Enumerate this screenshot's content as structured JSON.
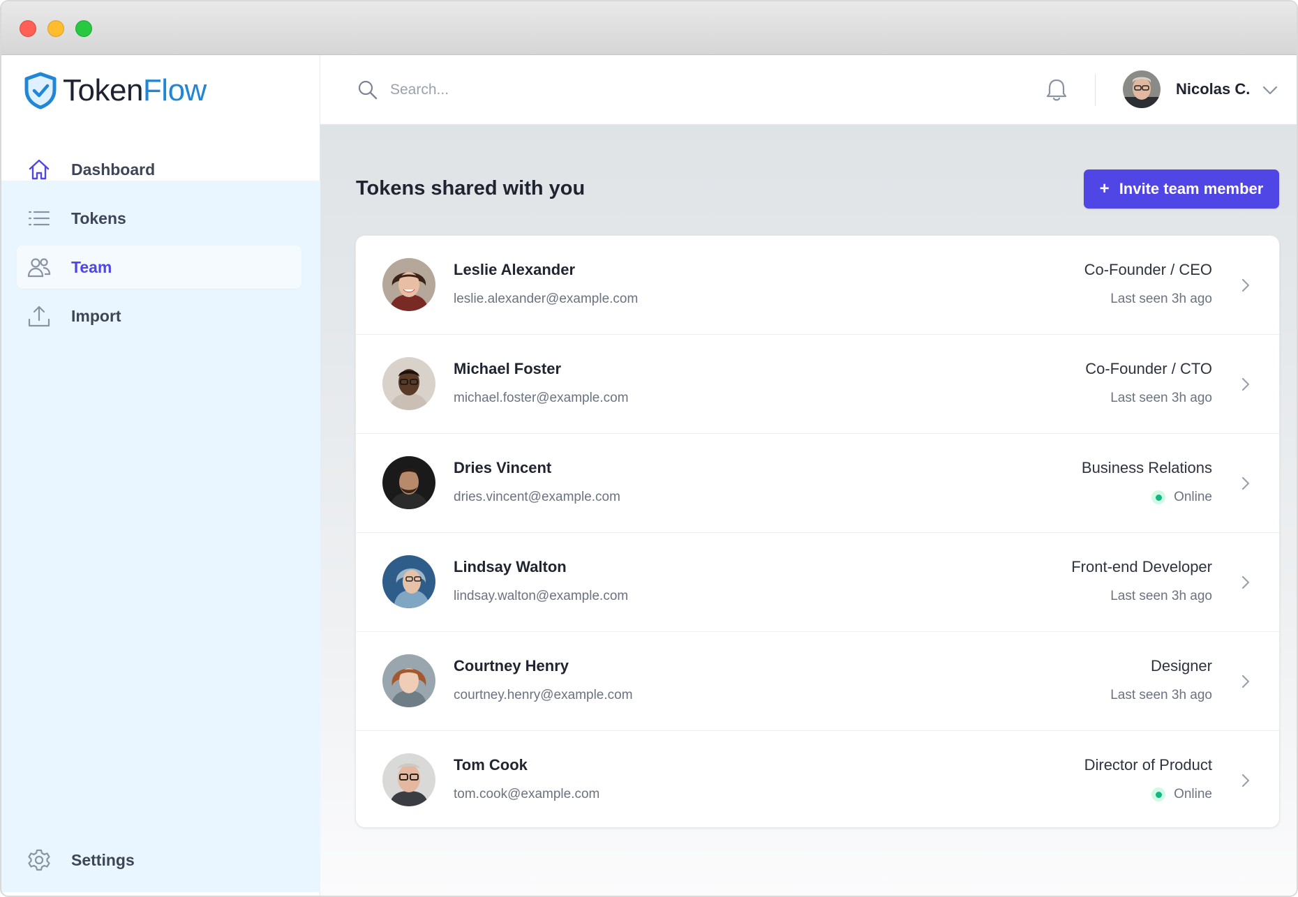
{
  "app": {
    "logo_part1": "Token",
    "logo_part2": "Flow"
  },
  "sidebar": {
    "items": [
      {
        "label": "Dashboard",
        "icon": "home-icon"
      },
      {
        "label": "Tokens",
        "icon": "list-icon"
      },
      {
        "label": "Team",
        "icon": "users-icon",
        "active": true
      },
      {
        "label": "Import",
        "icon": "upload-icon"
      }
    ],
    "settings_label": "Settings"
  },
  "topbar": {
    "search_placeholder": "Search...",
    "user_name": "Nicolas C."
  },
  "page": {
    "title": "Tokens shared with you",
    "invite_plus": "+",
    "invite_label": "Invite team member"
  },
  "members": [
    {
      "name": "Leslie Alexander",
      "email": "leslie.alexander@example.com",
      "role": "Co-Founder / CEO",
      "status": "Last seen 3h ago",
      "online": false
    },
    {
      "name": "Michael Foster",
      "email": "michael.foster@example.com",
      "role": "Co-Founder / CTO",
      "status": "Last seen 3h ago",
      "online": false
    },
    {
      "name": "Dries Vincent",
      "email": "dries.vincent@example.com",
      "role": "Business Relations",
      "status": "Online",
      "online": true
    },
    {
      "name": "Lindsay Walton",
      "email": "lindsay.walton@example.com",
      "role": "Front-end Developer",
      "status": "Last seen 3h ago",
      "online": false
    },
    {
      "name": "Courtney Henry",
      "email": "courtney.henry@example.com",
      "role": "Designer",
      "status": "Last seen 3h ago",
      "online": false
    },
    {
      "name": "Tom Cook",
      "email": "tom.cook@example.com",
      "role": "Director of Product",
      "status": "Online",
      "online": true
    }
  ],
  "colors": {
    "accent": "#4f46e5",
    "brand_blue": "#2186d6",
    "online_green": "#10b981",
    "sidebar_tint": "#e9f6ff"
  }
}
